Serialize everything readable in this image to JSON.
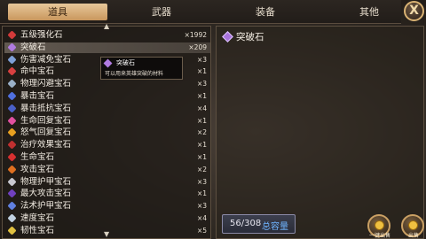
{
  "tabs": [
    {
      "label": "道具",
      "active": true
    },
    {
      "label": "武器",
      "active": false
    },
    {
      "label": "装备",
      "active": false
    },
    {
      "label": "其他",
      "active": false
    }
  ],
  "close_label": "X",
  "items": [
    {
      "name": "五级强化石",
      "qty": "×1992",
      "color": "#d23a3a"
    },
    {
      "name": "突破石",
      "qty": "×209",
      "color": "#b07be0"
    },
    {
      "name": "伤害减免宝石",
      "qty": "×3",
      "color": "#7fa0d8"
    },
    {
      "name": "命中宝石",
      "qty": "×1",
      "color": "#d84040"
    },
    {
      "name": "物理闪避宝石",
      "qty": "×3",
      "color": "#9ab0c8"
    },
    {
      "name": "暴击宝石",
      "qty": "×1",
      "color": "#5070e0"
    },
    {
      "name": "暴击抵抗宝石",
      "qty": "×4",
      "color": "#4a60c8"
    },
    {
      "name": "生命回复宝石",
      "qty": "×1",
      "color": "#e050a0"
    },
    {
      "name": "怒气回复宝石",
      "qty": "×2",
      "color": "#e8a020"
    },
    {
      "name": "治疗效果宝石",
      "qty": "×1",
      "color": "#c03030"
    },
    {
      "name": "生命宝石",
      "qty": "×1",
      "color": "#d83030"
    },
    {
      "name": "攻击宝石",
      "qty": "×2",
      "color": "#e07020"
    },
    {
      "name": "物理护甲宝石",
      "qty": "×3",
      "color": "#c8c8d0"
    },
    {
      "name": "最大攻击宝石",
      "qty": "×1",
      "color": "#7040c0"
    },
    {
      "name": "法术护甲宝石",
      "qty": "×3",
      "color": "#6080e0"
    },
    {
      "name": "速度宝石",
      "qty": "×4",
      "color": "#c0d0e0"
    },
    {
      "name": "韧性宝石",
      "qty": "×5",
      "color": "#e0c040"
    }
  ],
  "selected_index": 1,
  "tooltip": {
    "title": "突破石",
    "desc": "可以用来英雄突破的材料"
  },
  "detail": {
    "title": "突破石"
  },
  "capacity": {
    "count": "56/308",
    "label": "总容量"
  },
  "buttons": {
    "sell": "一键出售",
    "sell2": "出售"
  }
}
